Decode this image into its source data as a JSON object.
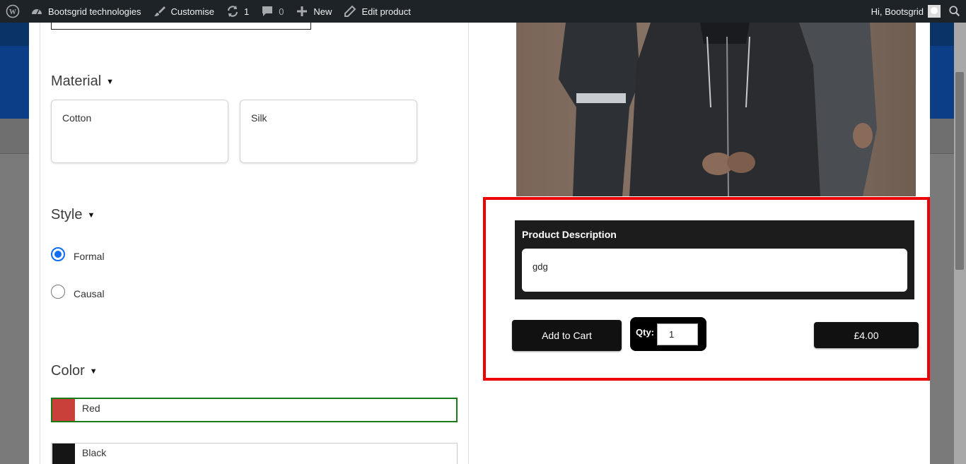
{
  "adminbar": {
    "site_name": "Bootsgrid technologies",
    "customise": "Customise",
    "updates_count": "1",
    "comments_count": "0",
    "new_label": "New",
    "edit_label": "Edit product",
    "greeting": "Hi, Bootsgrid"
  },
  "filters": {
    "material": {
      "title": "Material",
      "options": [
        "Cotton",
        "Silk"
      ]
    },
    "style": {
      "title": "Style",
      "options": [
        {
          "label": "Formal",
          "checked": true
        },
        {
          "label": "Causal",
          "checked": false
        }
      ]
    },
    "color": {
      "title": "Color",
      "options": [
        {
          "label": "Red",
          "swatch": "#c9403a",
          "selected": true
        },
        {
          "label": "Black",
          "swatch": "#151515",
          "selected": false
        }
      ]
    }
  },
  "product": {
    "description_title": "Product Description",
    "description_text": "gdg",
    "add_to_cart": "Add to Cart",
    "qty_label": "Qty:",
    "qty_value": "1",
    "price": "£4.00"
  },
  "colors": {
    "highlight": "#ee0000",
    "selected_border": "#1a7a1a",
    "radio_accent": "#0d6efd"
  }
}
